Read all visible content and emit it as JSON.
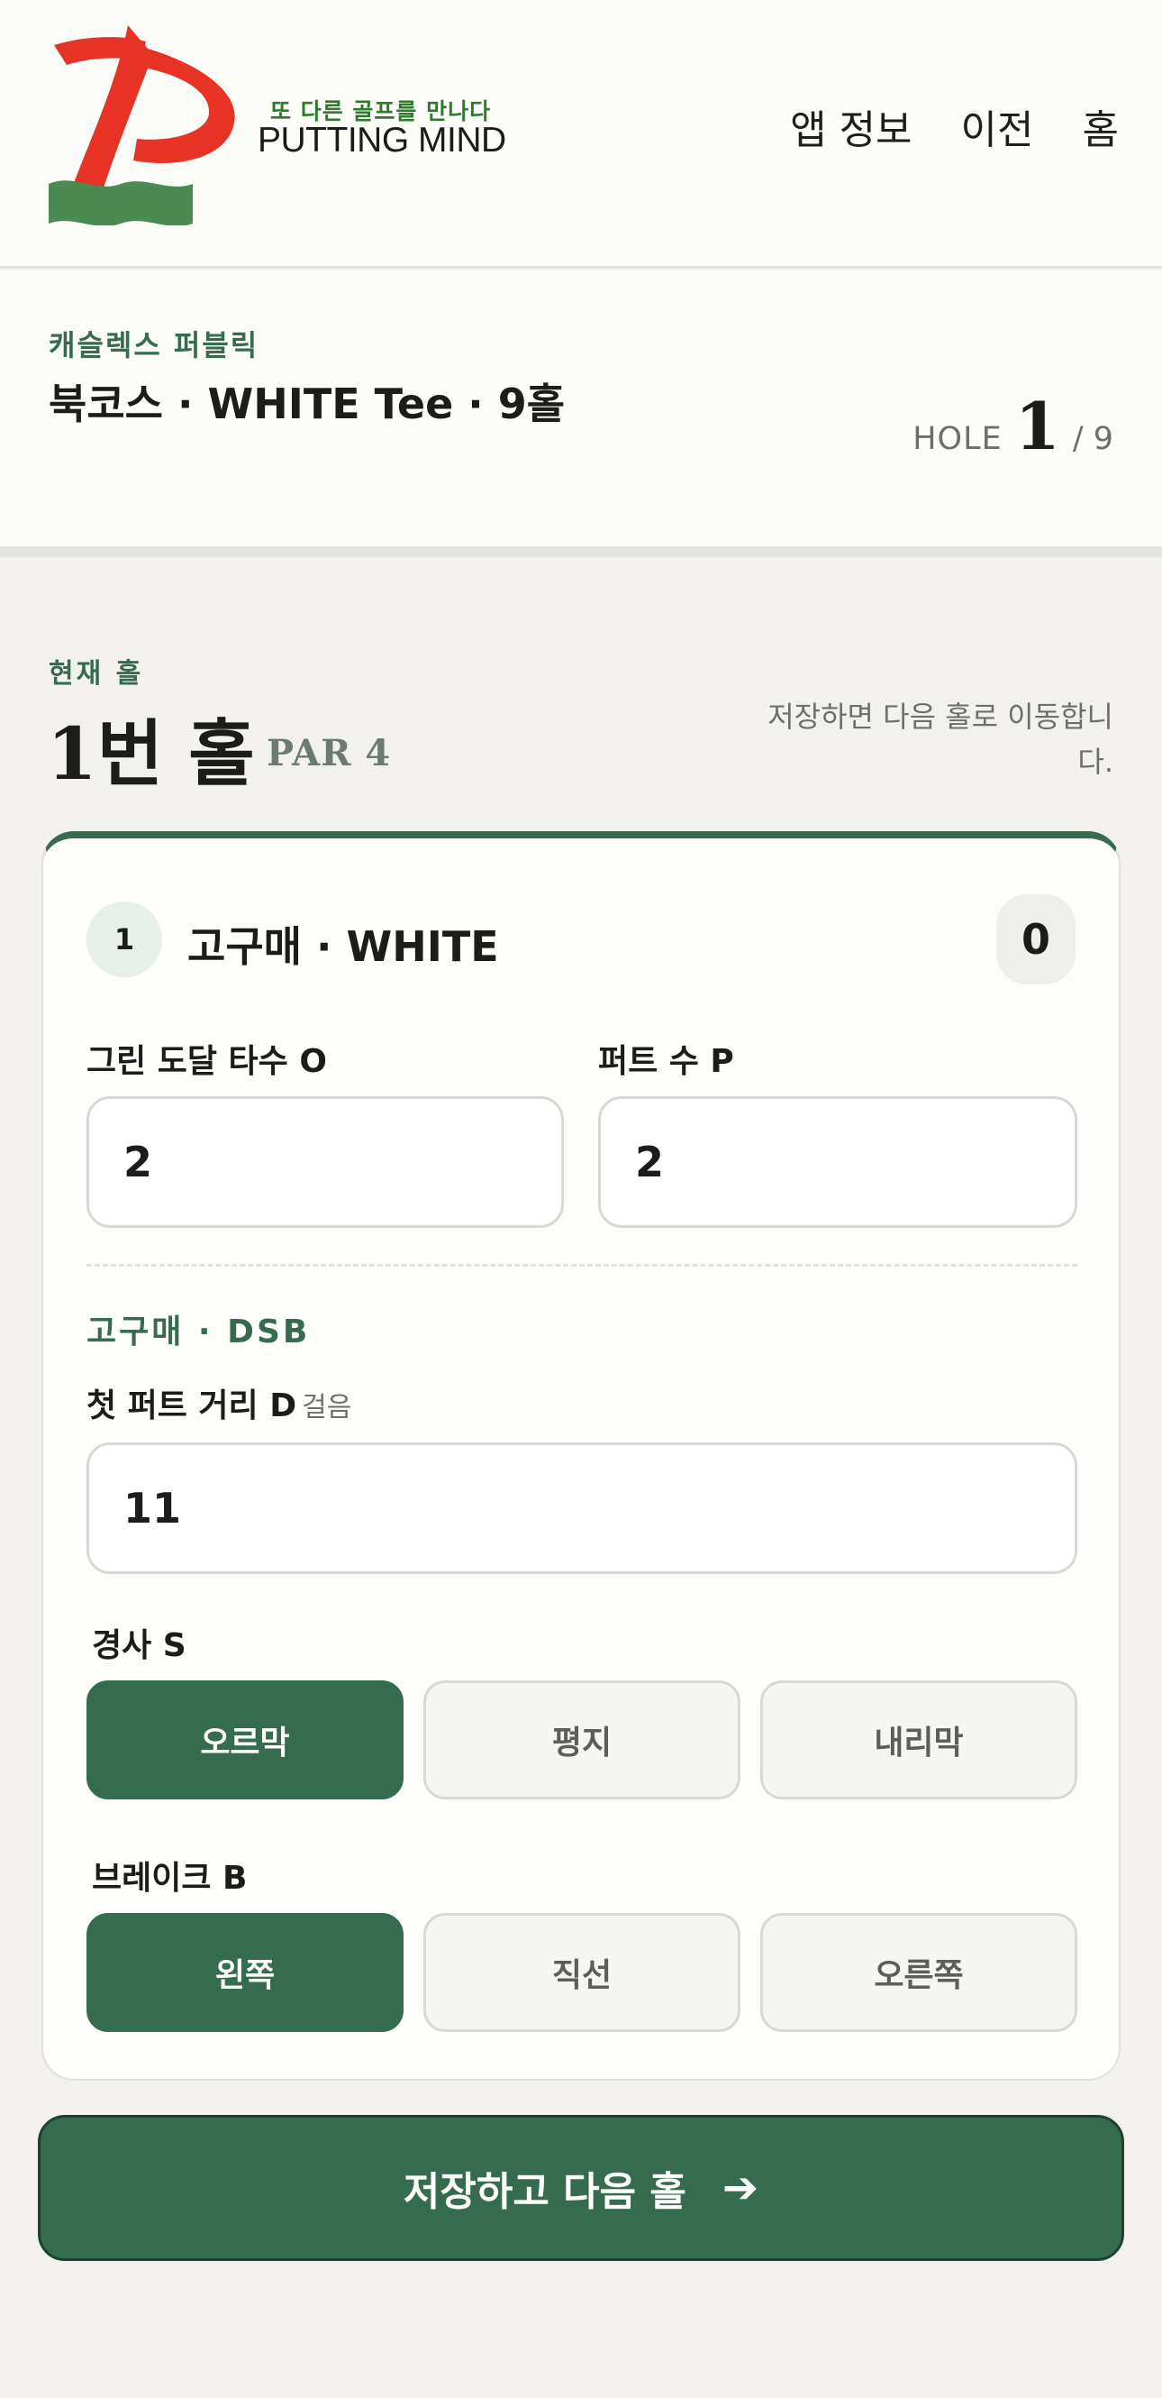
{
  "header": {
    "logo_tagline": "또 다른 골프를 만나다",
    "logo_name": "PUTTING MIND",
    "nav": [
      "앱 정보",
      "이전",
      "홈"
    ],
    "brand_colors": {
      "red": "#e63326",
      "green": "#4b8a52"
    }
  },
  "course": {
    "name": "캐슬렉스 퍼블릭",
    "info": "북코스 · WHITE Tee · 9홀",
    "hole_label": "HOLE",
    "hole_current": "1",
    "hole_total": "/ 9"
  },
  "current": {
    "label": "현재 홀",
    "title": "1번 홀",
    "par": "PAR 4",
    "hint": "저장하면 다음 홀로 이동합니다."
  },
  "player": {
    "number": "1",
    "name": "고구매 · WHITE",
    "score": "0"
  },
  "fields": {
    "green_label": "그린 도달 타수 O",
    "green_value": "2",
    "putts_label": "퍼트 수 P",
    "putts_value": "2",
    "section_label": "고구매 · DSB",
    "distance_label": "첫 퍼트 거리 D",
    "distance_unit": "걸음",
    "distance_value": "11",
    "slope_label": "경사 S",
    "slope_options": [
      "오르막",
      "평지",
      "내리막"
    ],
    "slope_selected": "오르막",
    "break_label": "브레이크 B",
    "break_options": [
      "왼쪽",
      "직선",
      "오른쪽"
    ],
    "break_selected": "왼쪽"
  },
  "submit": {
    "label": "저장하고 다음 홀",
    "icon": "arrow-right-icon"
  },
  "colors": {
    "accent": "#356b4f",
    "background": "#f2f1ed"
  }
}
